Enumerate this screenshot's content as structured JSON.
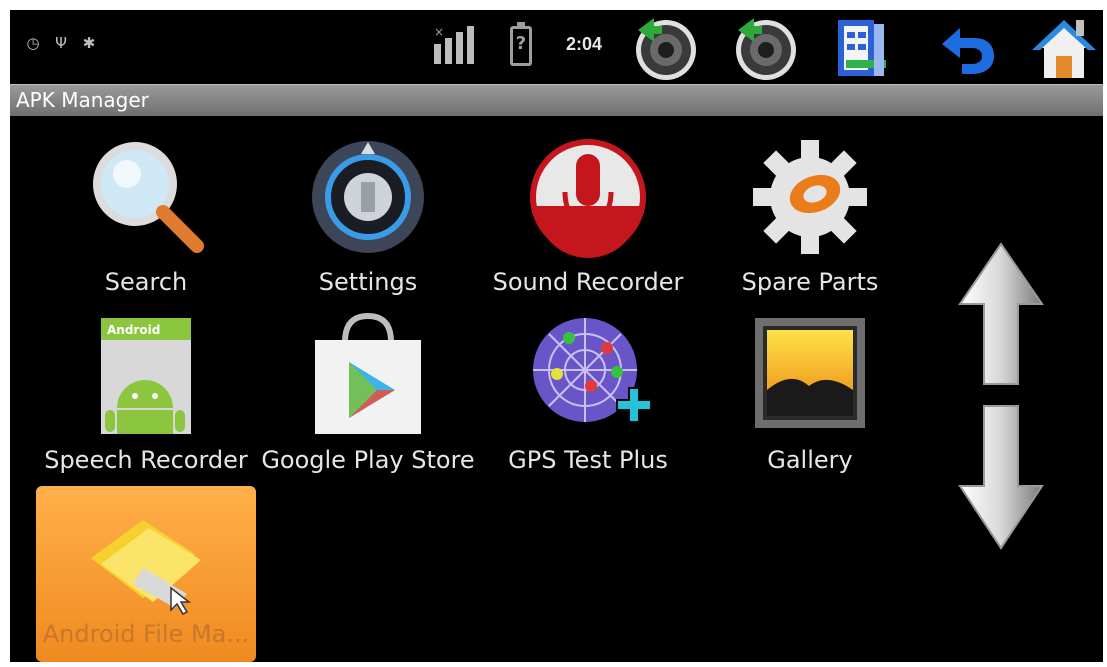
{
  "status_bar": {
    "time": "2:04",
    "battery_label": "?",
    "icons": [
      "clock-icon",
      "usb-icon",
      "android-debug-icon",
      "signal-icon",
      "battery-icon"
    ]
  },
  "system_buttons": [
    {
      "name": "volume-down-button",
      "icon": "speaker-minus-icon"
    },
    {
      "name": "volume-up-button",
      "icon": "speaker-plus-icon"
    },
    {
      "name": "menu-button",
      "icon": "menu-list-icon"
    },
    {
      "name": "back-button",
      "icon": "back-arrow-icon"
    },
    {
      "name": "home-button",
      "icon": "home-icon"
    }
  ],
  "title_bar": {
    "title": "APK Manager"
  },
  "apps": [
    {
      "label": "Search",
      "icon": "magnifier-icon"
    },
    {
      "label": "Settings",
      "icon": "settings-knob-icon"
    },
    {
      "label": "Sound Recorder",
      "icon": "microphone-icon"
    },
    {
      "label": "Spare Parts",
      "icon": "gear-icon"
    },
    {
      "label": "Speech Recorder",
      "icon": "android-speech-icon"
    },
    {
      "label": "Google Play Store",
      "icon": "play-store-bag-icon"
    },
    {
      "label": "GPS Test Plus",
      "icon": "gps-radar-icon"
    },
    {
      "label": "Gallery",
      "icon": "gallery-picture-icon"
    },
    {
      "label": "Android File Ma...",
      "icon": "folder-icon",
      "selected": true
    }
  ],
  "scroll": {
    "up": "arrow-up-icon",
    "down": "arrow-down-icon"
  },
  "colors": {
    "background": "#000000",
    "title_bar": "#8a8a8a",
    "selected_tile": "#f39a2c",
    "label_text": "#e6e6e6"
  }
}
